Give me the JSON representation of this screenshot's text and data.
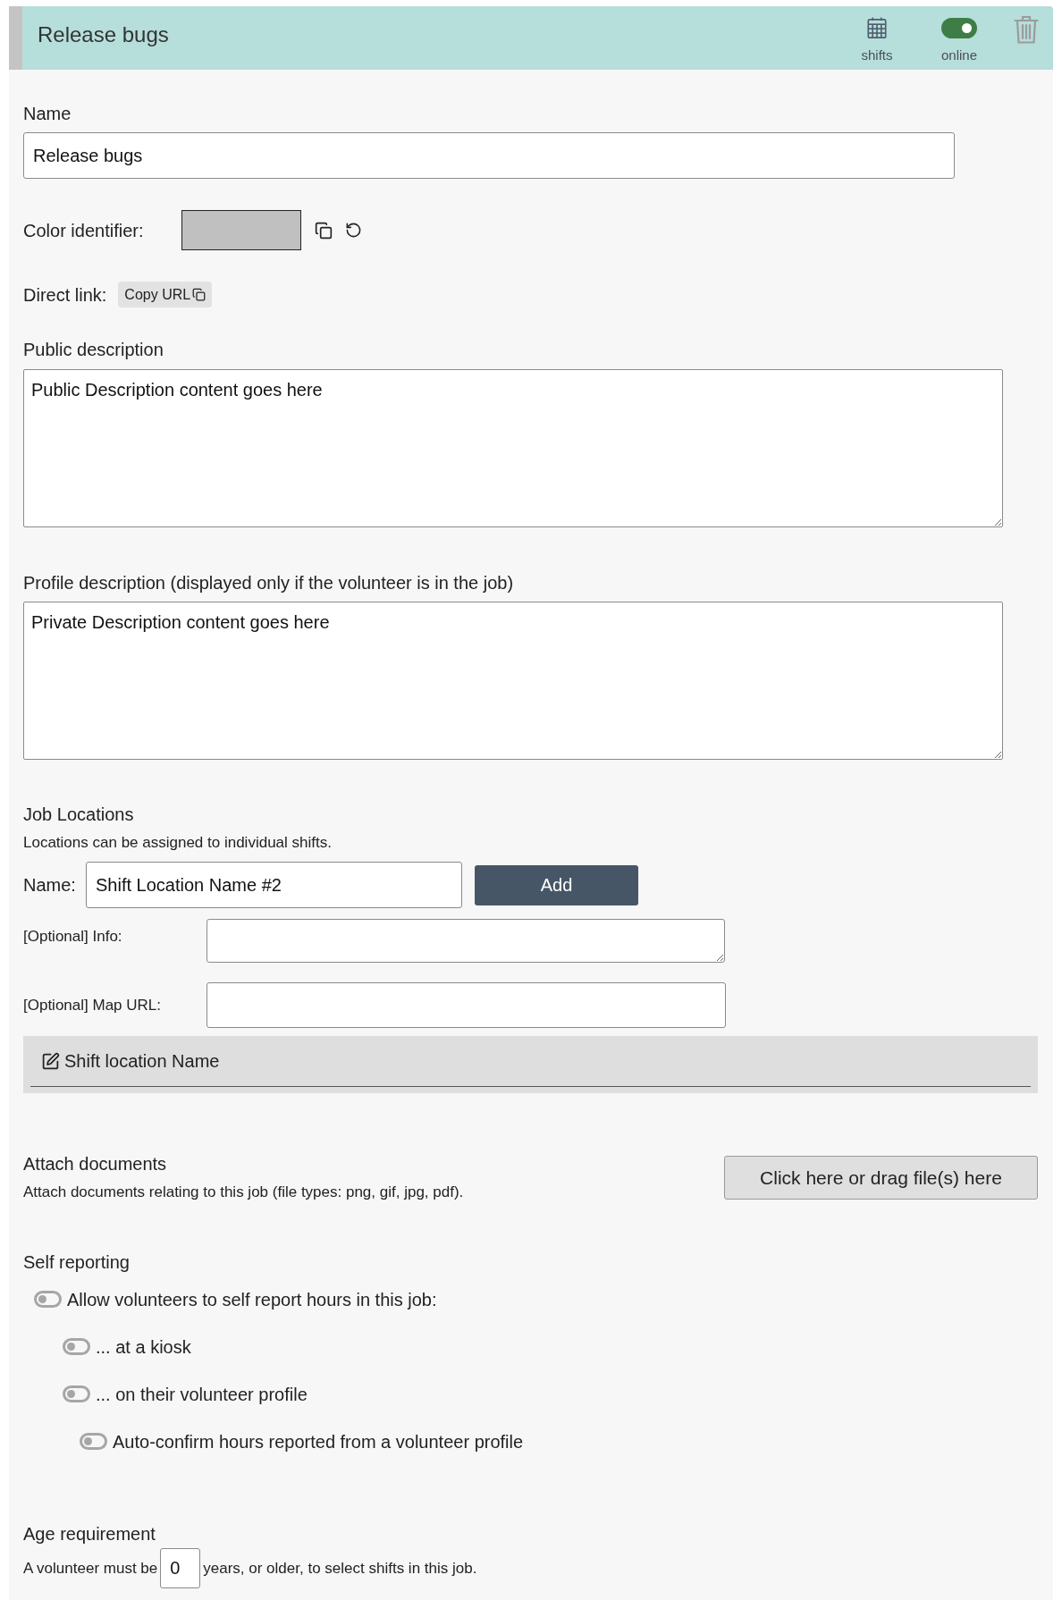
{
  "header": {
    "title": "Release bugs",
    "shifts_button": {
      "label": "shifts"
    },
    "online_toggle": {
      "label": "online",
      "on": true
    }
  },
  "name_field": {
    "label": "Name",
    "value": "Release bugs"
  },
  "color_identifier": {
    "label": "Color identifier:",
    "color": "#c0c0c0"
  },
  "direct_link": {
    "label": "Direct link:",
    "button": "Copy URL"
  },
  "public_description": {
    "label": "Public description",
    "value": "Public Description content goes here"
  },
  "profile_description": {
    "label": "Profile description (displayed only if the volunteer is in the job)",
    "value": "Private Description content goes here"
  },
  "job_locations": {
    "title": "Job Locations",
    "hint": "Locations can be assigned to individual shifts.",
    "name_label": "Name:",
    "name_value": "Shift Location Name #2",
    "add_button": "Add",
    "info_label": "[Optional] Info:",
    "map_label": "[Optional] Map URL:",
    "locations": [
      {
        "name": "Shift location Name"
      }
    ]
  },
  "attach_documents": {
    "title": "Attach documents",
    "hint": "Attach documents relating to this job (file types: png, gif, jpg, pdf).",
    "button": "Click here or drag file(s) here"
  },
  "self_reporting": {
    "title": "Self reporting",
    "options": [
      {
        "label": "Allow volunteers to self report hours in this job:",
        "on": false,
        "children": [
          {
            "label": "... at a kiosk",
            "on": false
          },
          {
            "label": "... on their volunteer profile",
            "on": false,
            "children": [
              {
                "label": "Auto-confirm hours reported from a volunteer profile",
                "on": false
              }
            ]
          }
        ]
      }
    ]
  },
  "age_requirement": {
    "title": "Age requirement",
    "text_before": "A volunteer must be",
    "value": "0",
    "text_after": "years, or older, to select shifts in this job."
  }
}
